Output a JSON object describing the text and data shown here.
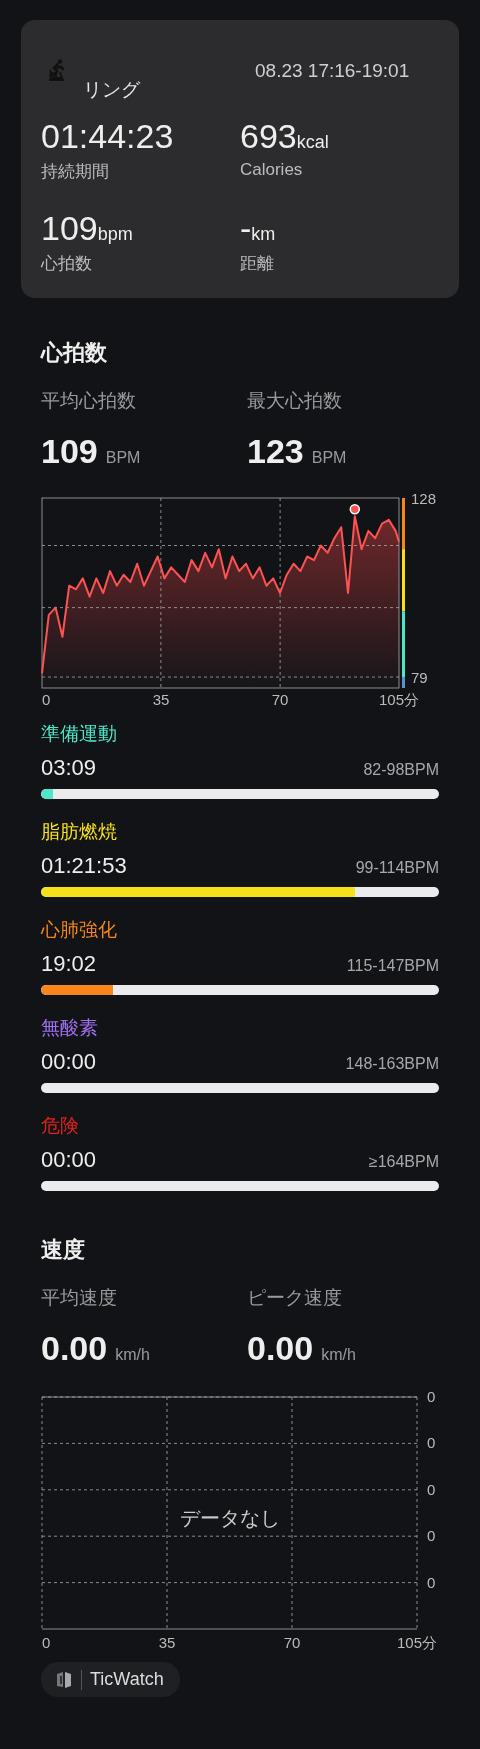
{
  "summary": {
    "title": "リング",
    "time_range": "08.23 17:16-19:01",
    "stats": [
      {
        "value": "01:44:23",
        "label": "持続期間"
      },
      {
        "value": "693",
        "unit": "kcal",
        "label": "Calories"
      },
      {
        "value": "109",
        "unit": "bpm",
        "label": "心拍数"
      },
      {
        "value": "-",
        "unit": "km",
        "label": "距離"
      }
    ]
  },
  "heart_rate": {
    "heading": "心拍数",
    "metrics": [
      {
        "label": "平均心拍数",
        "value": "109",
        "unit": "BPM"
      },
      {
        "label": "最大心拍数",
        "value": "123",
        "unit": "BPM"
      }
    ],
    "chart_data": {
      "type": "area",
      "x": [
        0,
        2,
        4,
        6,
        8,
        10,
        12,
        14,
        16,
        18,
        20,
        22,
        24,
        26,
        28,
        30,
        32,
        34,
        36,
        38,
        40,
        42,
        44,
        46,
        48,
        50,
        52,
        54,
        56,
        58,
        60,
        62,
        64,
        66,
        68,
        70,
        72,
        74,
        76,
        78,
        80,
        82,
        84,
        86,
        88,
        90,
        92,
        94,
        96,
        98,
        100,
        102,
        104,
        105
      ],
      "series": [
        {
          "color": "#ff5252",
          "values": [
            80,
            96,
            98,
            90,
            104,
            103,
            106,
            101,
            106,
            102,
            108,
            104,
            107,
            105,
            110,
            104,
            108,
            112,
            106,
            109,
            107,
            105,
            111,
            108,
            113,
            109,
            114,
            106,
            112,
            108,
            110,
            106,
            109,
            104,
            106,
            102,
            107,
            110,
            108,
            112,
            111,
            115,
            113,
            117,
            120,
            102,
            123,
            114,
            119,
            117,
            121,
            122,
            119,
            116
          ]
        }
      ],
      "xlim": [
        0,
        105
      ],
      "ylim": [
        76,
        128
      ],
      "xticks": [
        0,
        35,
        70,
        {
          "value": 105,
          "label": "105分"
        }
      ],
      "yticks": [
        79,
        128
      ],
      "grid": true
    },
    "zones": [
      {
        "name": "準備運動",
        "duration": "03:09",
        "range": "82-98BPM",
        "level": 0.03,
        "color": "#4de8c8"
      },
      {
        "name": "脂肪燃焼",
        "duration": "01:21:53",
        "range": "99-114BPM",
        "level": 0.79,
        "color": "#f5e11b"
      },
      {
        "name": "心肺強化",
        "duration": "19:02",
        "range": "115-147BPM",
        "level": 0.18,
        "color": "#f7861c"
      },
      {
        "name": "無酸素",
        "duration": "00:00",
        "range": "148-163BPM",
        "level": 0,
        "color": "#a070f0"
      },
      {
        "name": "危険",
        "duration": "00:00",
        "range": "≥164BPM",
        "level": 0,
        "color": "#e0201f"
      }
    ]
  },
  "speed": {
    "heading": "速度",
    "metrics": [
      {
        "label": "平均速度",
        "value": "0.00",
        "unit": "km/h"
      },
      {
        "label": "ピーク速度",
        "value": "0.00",
        "unit": "km/h"
      }
    ],
    "chart": {
      "y_labels": [
        "0",
        "0",
        "0",
        "0",
        "0"
      ],
      "x_labels": [
        "0",
        "35",
        "70",
        "105分"
      ],
      "message": "データなし"
    }
  },
  "source": {
    "name": "TicWatch"
  }
}
